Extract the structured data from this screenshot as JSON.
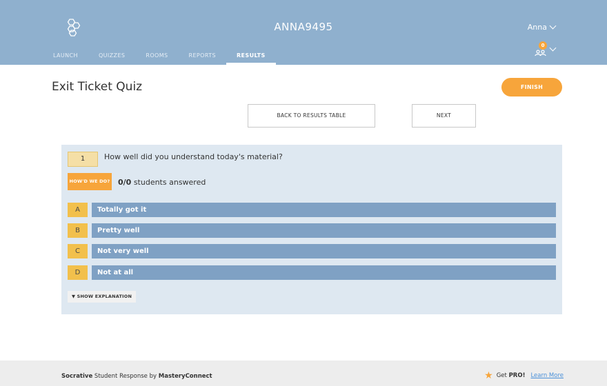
{
  "header": {
    "username": "ANNA9495",
    "user_menu_label": "Anna",
    "notification_count": "0"
  },
  "nav": {
    "items": [
      {
        "label": "LAUNCH"
      },
      {
        "label": "QUIZZES"
      },
      {
        "label": "ROOMS"
      },
      {
        "label": "REPORTS"
      },
      {
        "label": "RESULTS"
      }
    ],
    "active": "RESULTS"
  },
  "quiz": {
    "title": "Exit Ticket Quiz",
    "finish_label": "FINISH",
    "back_label": "BACK TO RESULTS TABLE",
    "next_label": "NEXT"
  },
  "question": {
    "number": "1",
    "text": "How well did you understand today's material?",
    "howd_label": "HOW'D WE DO?",
    "answered_count": "0/0",
    "answered_suffix": " students answered",
    "answers": [
      {
        "letter": "A",
        "text": "Totally got it"
      },
      {
        "letter": "B",
        "text": "Pretty well"
      },
      {
        "letter": "C",
        "text": "Not very well"
      },
      {
        "letter": "D",
        "text": "Not at all"
      }
    ],
    "explanation_label": "▼ SHOW EXPLANATION"
  },
  "footer": {
    "brand": "Socrative",
    "middle": " Student Response by ",
    "company": "MasteryConnect",
    "get_label": "Get ",
    "pro_label": "PRO!",
    "learn_label": "Learn More"
  },
  "colors": {
    "header_bg": "#8fb0ce",
    "accent_orange": "#f7a53b",
    "answer_bar": "#7fa1c4",
    "answer_letter": "#f2c04c",
    "panel_bg": "#dee8f1"
  }
}
